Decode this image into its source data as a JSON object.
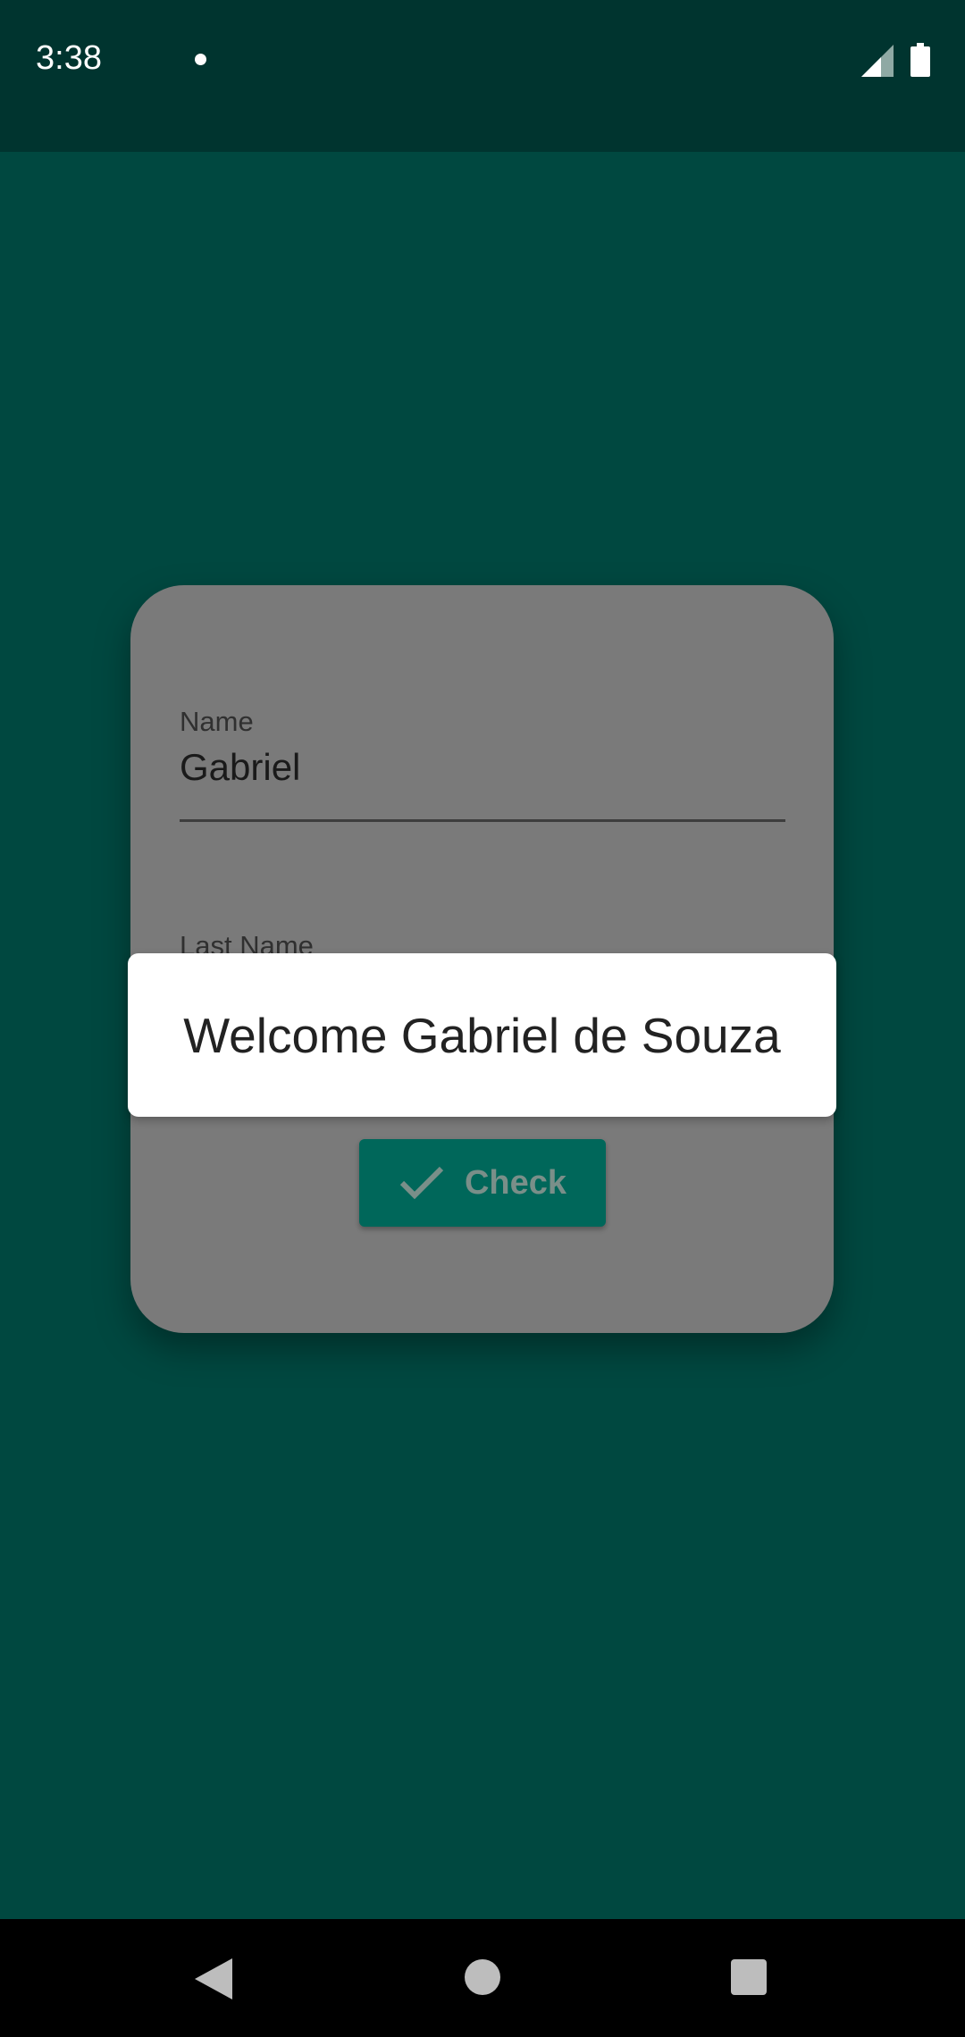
{
  "status_bar": {
    "time": "3:38",
    "icons": [
      "notification-dot-icon",
      "cell-signal-icon",
      "battery-icon"
    ]
  },
  "form": {
    "name_label": "Name",
    "name_value": "Gabriel",
    "last_name_label": "Last Name",
    "check_button_label": "Check",
    "check_icon": "check-icon"
  },
  "toast": {
    "message": "Welcome Gabriel de Souza"
  },
  "nav_bar": {
    "icons": [
      "back-icon",
      "home-icon",
      "recents-icon"
    ]
  },
  "colors": {
    "background": "#004840",
    "status_bar": "#00342f",
    "card_scrim": "#7a7a7a",
    "button": "#00675a",
    "toast": "#ffffff"
  }
}
